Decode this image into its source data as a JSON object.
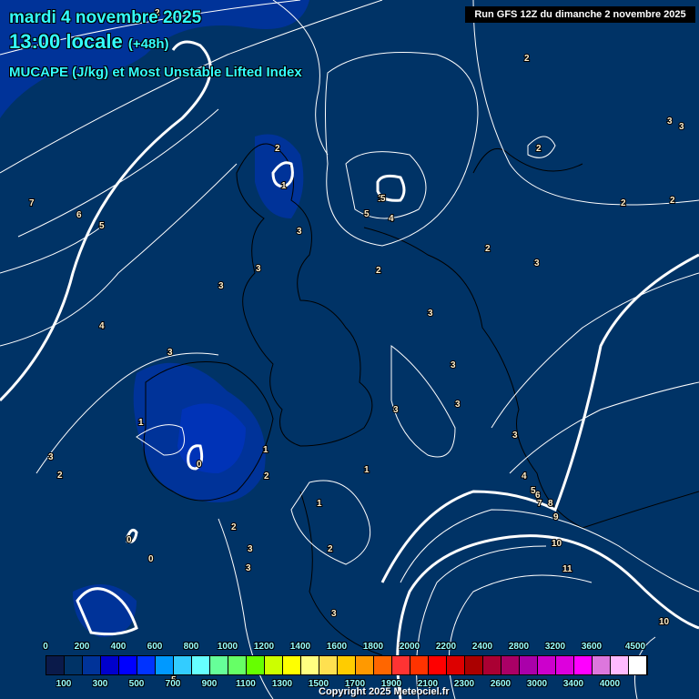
{
  "header": {
    "date": "mardi 4 novembre 2025",
    "time": "13:00 locale",
    "lead": "(+48h)",
    "parameter": "MUCAPE (J/kg) et Most Unstable Lifted Index",
    "run": "Run GFS 12Z du dimanche 2 novembre 2025"
  },
  "colorbar": {
    "top_labels": [
      "0",
      "200",
      "400",
      "600",
      "800",
      "1000",
      "1200",
      "1400",
      "1600",
      "1800",
      "2000",
      "2200",
      "2400",
      "2800",
      "3200",
      "3600",
      "4500"
    ],
    "bottom_labels": [
      "100",
      "300",
      "500",
      "700",
      "900",
      "1100",
      "1300",
      "1500",
      "1700",
      "1900",
      "2100",
      "2300",
      "2600",
      "3000",
      "3400",
      "4000"
    ],
    "colors": [
      "#0a1a4a",
      "#003366",
      "#003399",
      "#0000cc",
      "#0000ff",
      "#0033ff",
      "#0099ff",
      "#33ccff",
      "#66ffff",
      "#66ff99",
      "#66ff66",
      "#66ff00",
      "#ccff00",
      "#ffff00",
      "#ffff80",
      "#ffe050",
      "#ffcc00",
      "#ff9900",
      "#ff6600",
      "#ff3333",
      "#ff3300",
      "#ff0000",
      "#dd0000",
      "#aa0000",
      "#aa0033",
      "#aa0066",
      "#aa00aa",
      "#cc00cc",
      "#dd00dd",
      "#ff00ff",
      "#dd77dd",
      "#ffbbff",
      "#ffffff"
    ]
  },
  "contour_labels": [
    "7",
    "6",
    "5",
    "4",
    "3",
    "2",
    "1",
    "2",
    "1",
    "3",
    "3",
    "5",
    "5",
    "4",
    "2",
    "2",
    "2",
    "3",
    "3",
    "2",
    "3",
    "3",
    "3",
    "3",
    "1",
    "1",
    "0",
    "1",
    "2",
    "1",
    "2",
    "3",
    "3",
    "2",
    "0",
    "0",
    "5",
    "3",
    "4",
    "5",
    "6",
    "7",
    "8",
    "9",
    "10",
    "11",
    "10",
    "3",
    "2",
    "3",
    "2",
    "2",
    "3",
    "3"
  ],
  "copyright": "Copyright 2025 Meteociel.fr"
}
